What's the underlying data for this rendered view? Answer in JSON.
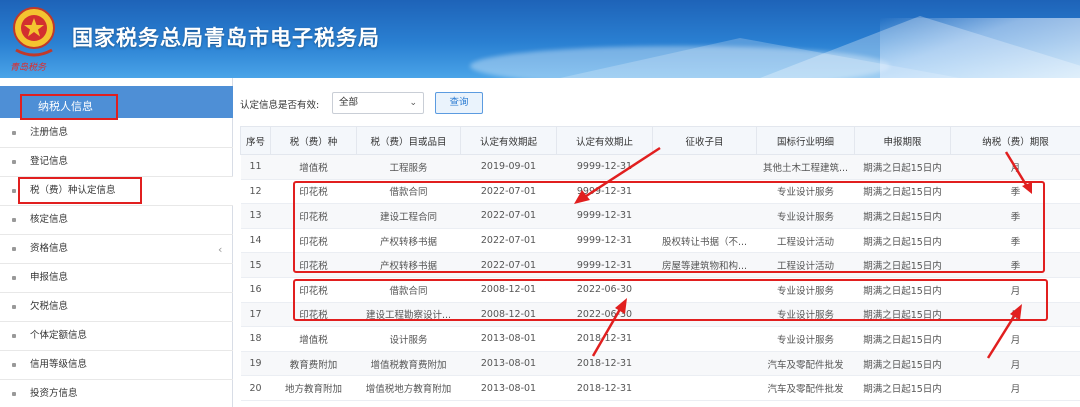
{
  "header": {
    "title": "国家税务总局青岛市电子税务局",
    "emblem_label": "青岛税务"
  },
  "sidebar": {
    "head_label": "纳税人信息",
    "items": [
      {
        "label": "注册信息"
      },
      {
        "label": "登记信息"
      },
      {
        "label": "税（费）种认定信息"
      },
      {
        "label": "核定信息"
      },
      {
        "label": "资格信息"
      },
      {
        "label": "申报信息"
      },
      {
        "label": "欠税信息"
      },
      {
        "label": "个体定额信息"
      },
      {
        "label": "信用等级信息"
      },
      {
        "label": "投资方信息"
      }
    ]
  },
  "filter": {
    "label": "认定信息是否有效:",
    "select_value": "全部",
    "query_label": "查询"
  },
  "table": {
    "columns": [
      "序号",
      "税（费）种",
      "税（费）目或品目",
      "认定有效期起",
      "认定有效期止",
      "征收子目",
      "国标行业明细",
      "申报期限",
      "纳税（费）期限"
    ],
    "rows": [
      [
        "11",
        "增值税",
        "工程服务",
        "2019-09-01",
        "9999-12-31",
        "",
        "其他土木工程建筑...",
        "期满之日起15日内",
        "月"
      ],
      [
        "12",
        "印花税",
        "借款合同",
        "2022-07-01",
        "9999-12-31",
        "",
        "专业设计服务",
        "期满之日起15日内",
        "季"
      ],
      [
        "13",
        "印花税",
        "建设工程合同",
        "2022-07-01",
        "9999-12-31",
        "",
        "专业设计服务",
        "期满之日起15日内",
        "季"
      ],
      [
        "14",
        "印花税",
        "产权转移书据",
        "2022-07-01",
        "9999-12-31",
        "股权转让书据（不...",
        "工程设计活动",
        "期满之日起15日内",
        "季"
      ],
      [
        "15",
        "印花税",
        "产权转移书据",
        "2022-07-01",
        "9999-12-31",
        "房屋等建筑物和构...",
        "工程设计活动",
        "期满之日起15日内",
        "季"
      ],
      [
        "16",
        "印花税",
        "借款合同",
        "2008-12-01",
        "2022-06-30",
        "",
        "专业设计服务",
        "期满之日起15日内",
        "月"
      ],
      [
        "17",
        "印花税",
        "建设工程勘察设计...",
        "2008-12-01",
        "2022-06-30",
        "",
        "专业设计服务",
        "期满之日起15日内",
        "月"
      ],
      [
        "18",
        "增值税",
        "设计服务",
        "2013-08-01",
        "2018-12-31",
        "",
        "专业设计服务",
        "期满之日起15日内",
        "月"
      ],
      [
        "19",
        "教育费附加",
        "增值税教育费附加",
        "2013-08-01",
        "2018-12-31",
        "",
        "汽车及零配件批发",
        "期满之日起15日内",
        "月"
      ],
      [
        "20",
        "地方教育附加",
        "增值税地方教育附加",
        "2013-08-01",
        "2018-12-31",
        "",
        "汽车及零配件批发",
        "期满之日起15日内",
        "月"
      ]
    ]
  },
  "colors": {
    "header_blue": "#2a80d2",
    "sidebar_head": "#4e8fd6",
    "annotation_red": "#e11f1f"
  }
}
